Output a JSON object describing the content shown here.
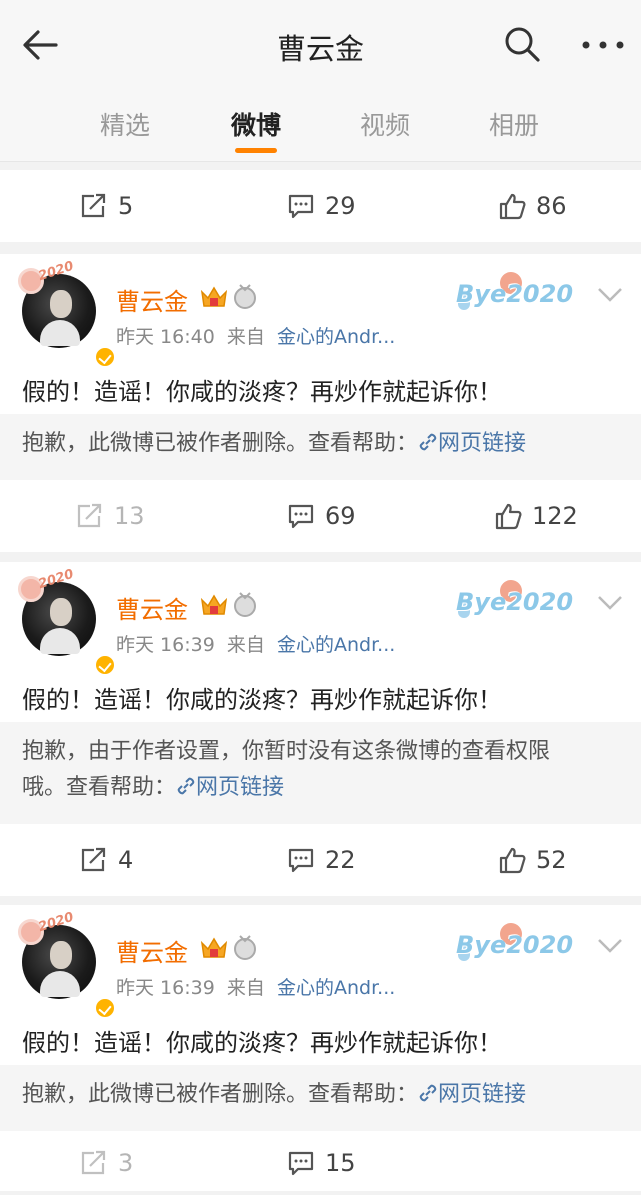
{
  "header": {
    "title": "曹云金",
    "back_icon": "arrow-left-icon",
    "search_icon": "search-icon",
    "more_icon": "more-dots-icon"
  },
  "tabs": [
    {
      "label": "精选",
      "active": false
    },
    {
      "label": "微博",
      "active": true
    },
    {
      "label": "视频",
      "active": false
    },
    {
      "label": "相册",
      "active": false
    }
  ],
  "accent_color": "#ff8200",
  "top_actions": {
    "repost": "5",
    "comment": "29",
    "like": "86"
  },
  "posts": [
    {
      "username": "曹云金",
      "time": "昨天 16:40",
      "from_label": "来自",
      "source": "金心的Andr...",
      "deco": "Bye2020",
      "text": "假的！造谣！你咸的淡疼？再炒作就起诉你！",
      "notice": "抱歉，此微博已被作者删除。查看帮助：",
      "notice_link": "网页链接",
      "repost": "13",
      "comment": "69",
      "like": "122",
      "repost_dim": true
    },
    {
      "username": "曹云金",
      "time": "昨天 16:39",
      "from_label": "来自",
      "source": "金心的Andr...",
      "deco": "Bye2020",
      "text": "假的！造谣！你咸的淡疼？再炒作就起诉你！",
      "notice_line1": "抱歉，由于作者设置，你暂时没有这条微博的查看权限",
      "notice_line2": "哦。查看帮助：",
      "notice_link": "网页链接",
      "repost": "4",
      "comment": "22",
      "like": "52",
      "repost_dim": false
    },
    {
      "username": "曹云金",
      "time": "昨天 16:39",
      "from_label": "来自",
      "source": "金心的Andr...",
      "deco": "Bye2020",
      "text": "假的！造谣！你咸的淡疼？再炒作就起诉你！",
      "notice": "抱歉，此微博已被作者删除。查看帮助：",
      "notice_link": "网页链接",
      "repost": "3",
      "comment": "15",
      "repost_dim": true
    }
  ]
}
